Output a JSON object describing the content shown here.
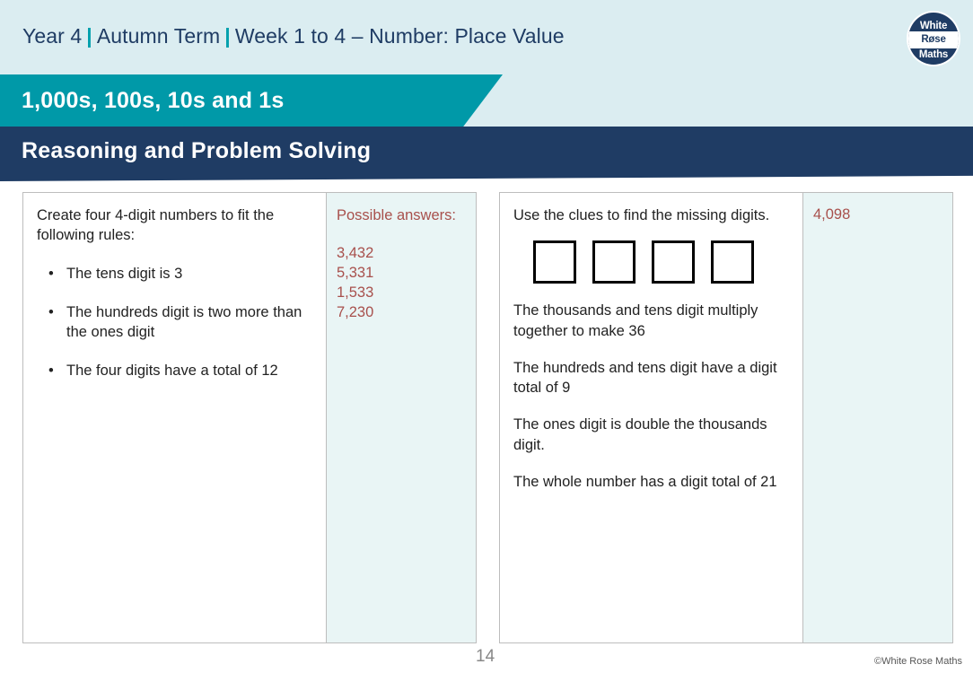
{
  "header": {
    "year": "Year 4",
    "term": "Autumn Term",
    "week": "Week 1 to 4 – Number: Place Value",
    "separator": "|",
    "banner_title": "1,000s, 100s, 10s and 1s",
    "banner_subtitle": "Reasoning and Problem Solving",
    "logo": {
      "line1": "White",
      "line2": "Røse",
      "line3": "Maths"
    }
  },
  "colors": {
    "teal": "#0099a8",
    "navy": "#1f3c64",
    "pale_blue": "#dbedf1",
    "answer_tint": "#e9f5f5",
    "answer_text": "#a8504c"
  },
  "panels": [
    {
      "question": {
        "intro": "Create four 4-digit numbers to fit the following rules:",
        "bullets": [
          "The tens digit is 3",
          "The hundreds digit is two more than the ones digit",
          "The four digits have a total of 12"
        ],
        "bullet_marker": "•"
      },
      "answer": {
        "heading": "Possible answers:",
        "values": [
          "3,432",
          "5,331",
          "1,533",
          "7,230"
        ]
      }
    },
    {
      "question": {
        "intro": "Use the clues to find the missing digits.",
        "digit_boxes": [
          "",
          "",
          "",
          ""
        ],
        "clues": [
          "The thousands and tens digit multiply together to make 36",
          "The hundreds and tens digit have a digit total of 9",
          "The ones digit is double the thousands digit.",
          "The whole number has a digit total of 21"
        ]
      },
      "answer": {
        "heading": "",
        "values": [
          "4,098"
        ]
      }
    }
  ],
  "footer": {
    "page_number": "14",
    "copyright": "©White Rose Maths"
  }
}
